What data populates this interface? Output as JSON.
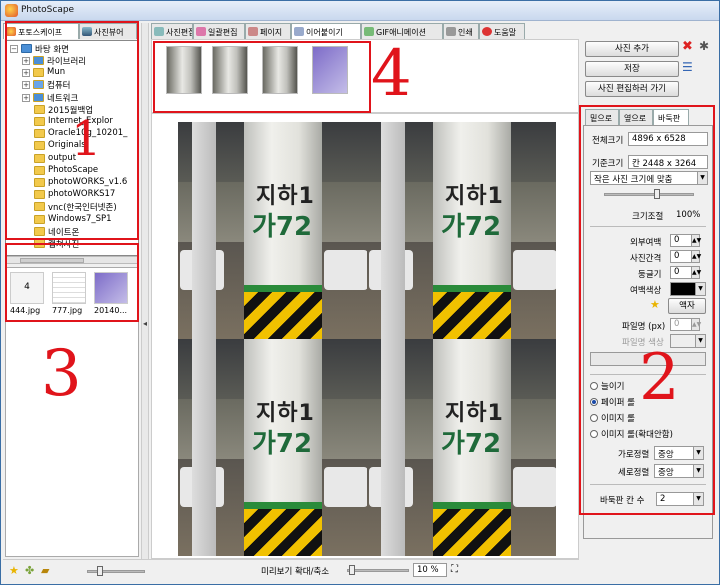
{
  "window": {
    "title": "PhotoScape"
  },
  "left_tabs": [
    "포토스케이프",
    "사진뷰어"
  ],
  "main_tabs": [
    "사진편집",
    "일괄편집",
    "페이지",
    "이어붙이기",
    "GIF애니메이션",
    "인쇄",
    "도움말"
  ],
  "tree": {
    "root": "바탕 화면",
    "items": [
      "라이브러리",
      "Mun",
      "컴퓨터",
      "네트워크",
      "2015월백업",
      "Internet_Explor",
      "Oracle10g_10201_",
      "Originals",
      "output",
      "PhotoScape",
      "photoWORKS_v1.6",
      "photoWORKS17",
      "vnc(한국인터넷존)",
      "Windows7_SP1",
      "네이트온",
      "캡쳐사진"
    ]
  },
  "thumbnails": [
    {
      "name": "444.jpg",
      "overlay": "4"
    },
    {
      "name": "777.jpg",
      "overlay": ""
    },
    {
      "name": "20140...",
      "overlay": ""
    }
  ],
  "buttons": {
    "add_photo": "사진 추가",
    "save": "저장",
    "go_photo_edit": "사진 편집하러 가기"
  },
  "right_tabs": [
    "밑으로",
    "옆으로",
    "바둑판"
  ],
  "right": {
    "full_size_label": "전체크기",
    "full_size_value": "4896 x 6528",
    "base_size_label": "기준크기",
    "base_size_value": "칸 2448 x 3264",
    "fit_select": "작은 사진 크기에 맞춤",
    "resize_label": "크기조절",
    "resize_value": "100%",
    "outer_margin_label": "외부여백",
    "outer_margin_value": "0",
    "photo_gap_label": "사진간격",
    "photo_gap_value": "0",
    "round_label": "둥글기",
    "round_value": "0",
    "margin_color_label": "여백색상",
    "margin_color": "#000000",
    "text_button": "액자",
    "filename_label": "파일명 (px)",
    "filename_value": "0",
    "filename_color_label": "파일명 색상",
    "options": [
      "늘이기",
      "페이퍼 롤",
      "이미지 롤",
      "이미지 롤(확대안함)"
    ],
    "selected_option": 1,
    "h_align_label": "가로정렬",
    "h_align_value": "중앙",
    "v_align_label": "세로정렬",
    "v_align_value": "중앙",
    "grid_cols_label": "바둑판 칸 수",
    "grid_cols_value": "2"
  },
  "preview": {
    "sign_line1": "지하1",
    "sign_line2": "가72"
  },
  "status": {
    "zoom_label": "미리보기 확대/축소",
    "zoom_value": "10 %"
  },
  "annotations": {
    "n1": "1",
    "n2": "2",
    "n3": "3",
    "n4": "4",
    "color": "#e0141b"
  }
}
